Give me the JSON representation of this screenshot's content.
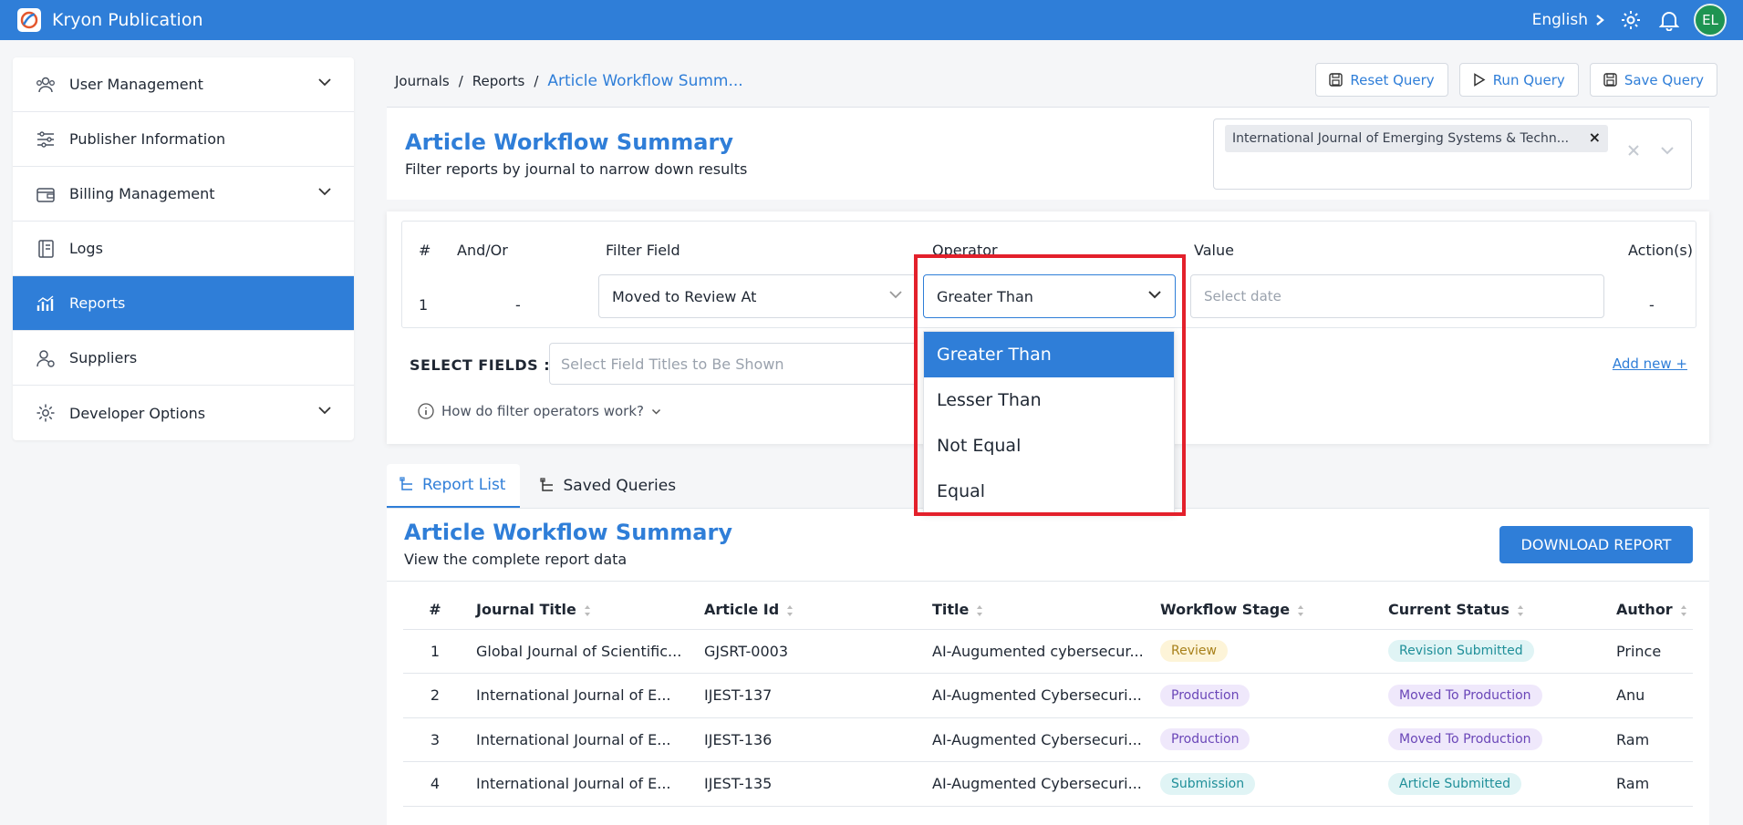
{
  "app": {
    "title": "Kryon Publication",
    "language": "English",
    "user_initials": "EL"
  },
  "sidebar": {
    "items": [
      {
        "label": "User Management",
        "icon": "users-icon",
        "expandable": true,
        "active": false
      },
      {
        "label": "Publisher Information",
        "icon": "sliders-icon",
        "expandable": false,
        "active": false
      },
      {
        "label": "Billing Management",
        "icon": "wallet-icon",
        "expandable": true,
        "active": false
      },
      {
        "label": "Logs",
        "icon": "notebook-icon",
        "expandable": false,
        "active": false
      },
      {
        "label": "Reports",
        "icon": "chart-icon",
        "expandable": false,
        "active": true
      },
      {
        "label": "Suppliers",
        "icon": "user-gear-icon",
        "expandable": false,
        "active": false
      },
      {
        "label": "Developer Options",
        "icon": "gear-icon",
        "expandable": true,
        "active": false
      }
    ]
  },
  "breadcrumb": {
    "items": [
      "Journals",
      "Reports"
    ],
    "current": "Article Workflow Summ..."
  },
  "toolbar": {
    "reset": "Reset Query",
    "run": "Run Query",
    "save": "Save Query"
  },
  "header": {
    "title": "Article Workflow Summary",
    "subtitle": "Filter reports by journal to narrow down results",
    "journal_chip": "International Journal of Emerging Systems & Techn..."
  },
  "filter": {
    "headers": {
      "num": "#",
      "and_or": "And/Or",
      "field": "Filter Field",
      "operator": "Operator",
      "value": "Value",
      "actions": "Action(s)"
    },
    "row": {
      "num": "1",
      "and_or": "-",
      "field": "Moved to Review At",
      "operator": "Greater Than",
      "value_placeholder": "Select date",
      "actions": "-"
    },
    "select_fields_label": "SELECT FIELDS :",
    "select_fields_placeholder": "Select Field Titles to Be Shown",
    "add_new": "Add new +",
    "help": "How do filter operators work?",
    "operator_options": [
      "Greater Than",
      "Lesser Than",
      "Not Equal",
      "Equal"
    ]
  },
  "tabs": {
    "report_list": "Report List",
    "saved_queries": "Saved Queries"
  },
  "report": {
    "title": "Article Workflow Summary",
    "subtitle": "View the complete report data",
    "download": "DOWNLOAD REPORT",
    "columns": [
      "#",
      "Journal Title",
      "Article Id",
      "Title",
      "Workflow Stage",
      "Current Status",
      "Author"
    ],
    "rows": [
      {
        "num": "1",
        "journal": "Global Journal of Scientific...",
        "id": "GJSRT-0003",
        "title": "AI-Augumented cybersecur...",
        "stage": "Review",
        "status": "Revision Submitted",
        "author": "Prince"
      },
      {
        "num": "2",
        "journal": "International Journal of E...",
        "id": "IJEST-137",
        "title": "AI-Augmented Cybersecuri...",
        "stage": "Production",
        "status": "Moved To Production",
        "author": "Anu"
      },
      {
        "num": "3",
        "journal": "International Journal of E...",
        "id": "IJEST-136",
        "title": "AI-Augmented Cybersecuri...",
        "stage": "Production",
        "status": "Moved To Production",
        "author": "Ram"
      },
      {
        "num": "4",
        "journal": "International Journal of E...",
        "id": "IJEST-135",
        "title": "AI-Augmented Cybersecuri...",
        "stage": "Submission",
        "status": "Article Submitted",
        "author": "Ram"
      }
    ]
  },
  "colors": {
    "primary": "#2f7ed8",
    "highlight": "#e3202b",
    "stage_review": {
      "bg": "#fdf4d8",
      "fg": "#a8801a"
    },
    "stage_production": {
      "bg": "#efe8fb",
      "fg": "#6a46b8"
    },
    "stage_submission": {
      "bg": "#e0f4f5",
      "fg": "#1f8f99"
    },
    "status_revision": {
      "bg": "#e0f4f5",
      "fg": "#1f8f99"
    },
    "status_production": {
      "bg": "#efe8fb",
      "fg": "#6a46b8"
    },
    "status_submitted": {
      "bg": "#e0f4f5",
      "fg": "#1f8f99"
    }
  }
}
